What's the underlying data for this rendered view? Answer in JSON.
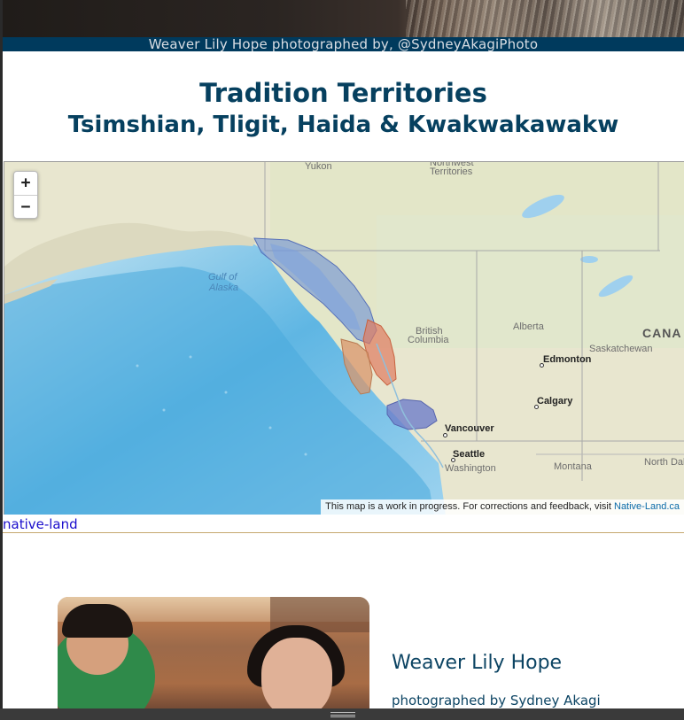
{
  "hero": {
    "caption": "Weaver Lily Hope photographed by, @SydneyAkagiPhoto"
  },
  "heading": {
    "title": "Tradition Territories",
    "subtitle": "Tsimshian, Tligit, Haida & Kwakwakawakw"
  },
  "map": {
    "zoom_in_label": "+",
    "zoom_out_label": "−",
    "attribution_text": "This map is a work in progress. For corrections and feedback, visit ",
    "attribution_link": "Native-Land.ca",
    "labels": {
      "yukon": "Yukon",
      "northwest_1": "Northwest",
      "northwest_2": "Territories",
      "gulf_1": "Gulf of",
      "gulf_2": "Alaska",
      "bc_1": "British",
      "bc_2": "Columbia",
      "alberta": "Alberta",
      "saskatchewan": "Saskatchewan",
      "canada": "CANA",
      "edmonton": "Edmonton",
      "calgary": "Calgary",
      "vancouver": "Vancouver",
      "seattle": "Seattle",
      "washington": "Washington",
      "montana": "Montana",
      "north_dakota": "North Dak"
    },
    "territory_colors": {
      "tlingit": "#6b8fd6",
      "haida": "#d9956b",
      "tsimshian": "#e07a5f",
      "kwakwakawakw": "#6e7ec9"
    }
  },
  "link": {
    "label": "native-land"
  },
  "feature": {
    "title": "Weaver Lily Hope",
    "subtitle": "photographed by Sydney Akagi"
  }
}
